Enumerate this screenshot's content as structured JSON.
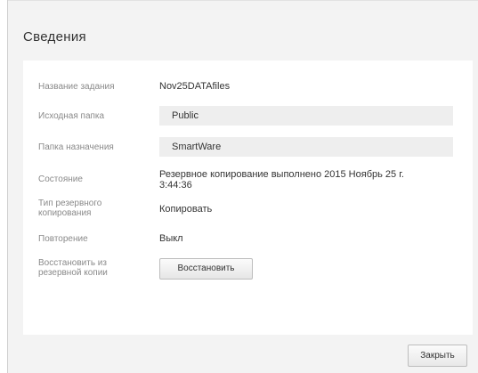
{
  "dialog": {
    "title": "Сведения"
  },
  "details": {
    "job_name_label": "Название задания",
    "job_name_value": "Nov25DATAfiles",
    "source_folder_label": "Исходная папка",
    "source_folder_value": "Public",
    "destination_folder_label": "Папка назначения",
    "destination_folder_value": "SmartWare",
    "status_label": "Состояние",
    "status_value_line1": "Резервное копирование выполнено 2015 Ноябрь 25 г.",
    "status_value_line2": "3:44:36",
    "backup_type_label_line1": "Тип резервного",
    "backup_type_label_line2": "копирования",
    "backup_type_value": "Копировать",
    "repeat_label": "Повторение",
    "repeat_value": "Выкл",
    "restore_label_line1": "Восстановить из",
    "restore_label_line2": "резервной копии",
    "restore_button_label": "Восстановить"
  },
  "footer": {
    "close_button_label": "Закрыть"
  }
}
